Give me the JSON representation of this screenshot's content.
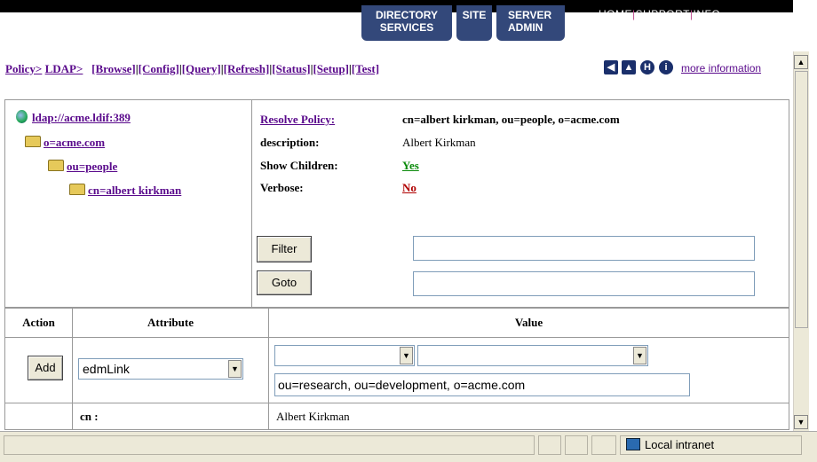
{
  "header": {
    "tabs": [
      {
        "line1": "DIRECTORY",
        "line2": "SERVICES"
      },
      {
        "line1": "SITE",
        "line2": ""
      },
      {
        "line1": "SERVER",
        "line2": "ADMIN"
      }
    ],
    "top_links": [
      "HOME",
      "SUPPORT",
      "INFO"
    ]
  },
  "toolbar": {
    "crumb_policy": "Policy>",
    "crumb_ldap": "LDAP>",
    "links": [
      "[Browse]",
      "[Config]",
      "[Query]",
      "[Refresh]",
      "[Status]",
      "[Setup]",
      "[Test]"
    ],
    "more_info": "more information"
  },
  "tree": {
    "root": "ldap://acme.ldif:389",
    "level1": "o=acme.com",
    "level2": "ou=people",
    "level3": "cn=albert kirkman"
  },
  "properties": {
    "resolve_label": "Resolve Policy:",
    "resolve_value": "cn=albert kirkman, ou=people, o=acme.com",
    "description_label": "description:",
    "description_value": "Albert Kirkman",
    "children_label": "Show Children:",
    "children_value": "Yes",
    "verbose_label": "Verbose:",
    "verbose_value": "No",
    "filter_button": "Filter",
    "goto_button": "Goto",
    "filter_input": "",
    "goto_input": ""
  },
  "table": {
    "headers": [
      "Action",
      "Attribute",
      "Value"
    ],
    "add_button": "Add",
    "attribute_select": "edmLink",
    "value_select_1": "",
    "value_select_2": "",
    "value_input": "ou=research, ou=development, o=acme.com",
    "row2_attr": "cn :",
    "row2_value": "Albert Kirkman"
  },
  "statusbar": {
    "zone": "Local intranet"
  },
  "colors": {
    "nav_tab": "#33487a",
    "link": "#5a0a8c",
    "yes": "#0a8a0a",
    "no": "#b00000"
  }
}
